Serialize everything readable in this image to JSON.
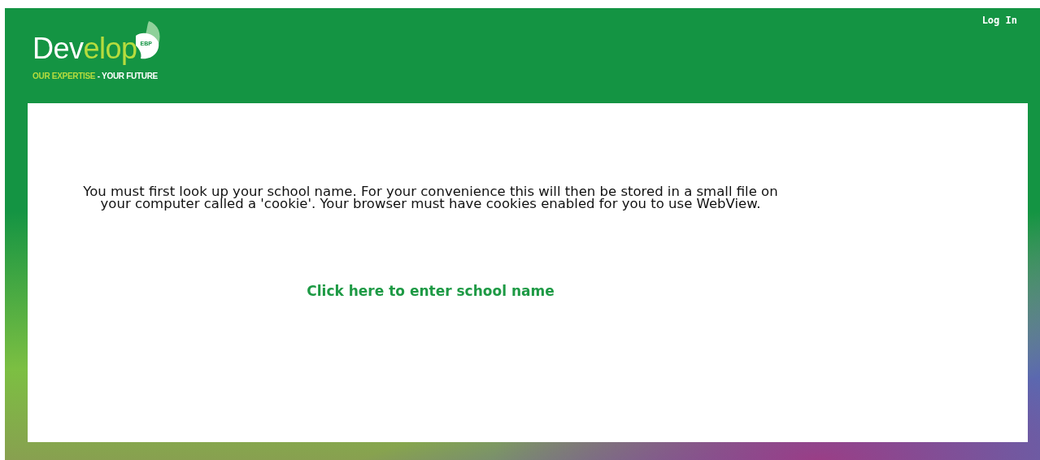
{
  "header": {
    "logo": {
      "part_1": "Dev",
      "part_2": "elop",
      "badge": "EBP"
    },
    "tagline": {
      "part_1": "OUR EXPERTISE",
      "part_2": " - YOUR FUTURE"
    },
    "login_link": "Log In"
  },
  "content": {
    "message": "You must first look up your school name. For your convenience this will then be stored in a small file on your computer called a 'cookie'. Your browser must have cookies enabled for you to use WebView.",
    "link": "Click here to enter school name"
  }
}
